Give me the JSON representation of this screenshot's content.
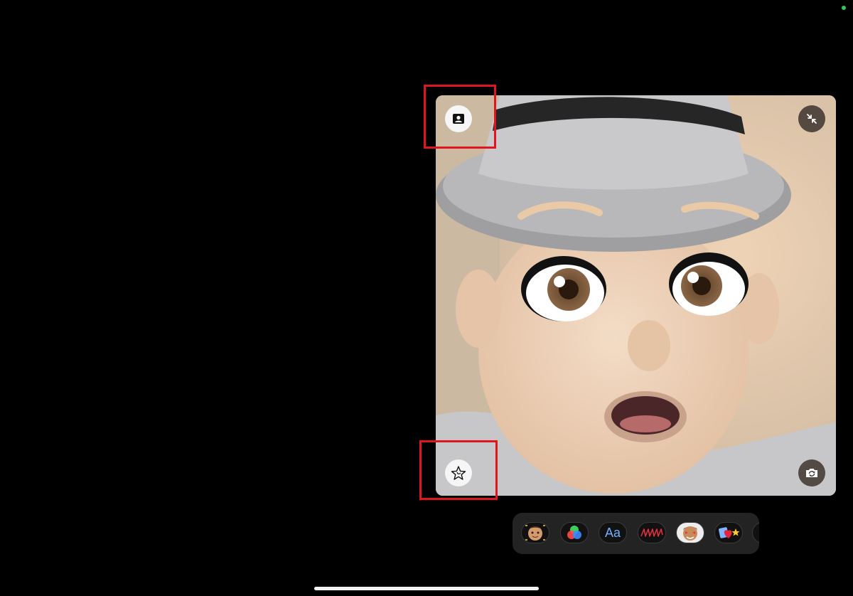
{
  "colors": {
    "background": "#000000",
    "status_dot": "#34c759",
    "highlight": "#e0161e",
    "tray": "#232323",
    "text_effect": "#6fb2ff",
    "home_indicator": "#f2f2f2"
  },
  "camera_tile": {
    "top_left_button": {
      "icon": "person-portrait-icon"
    },
    "top_right_button": {
      "icon": "minimize-arrows-icon"
    },
    "bottom_left_button": {
      "icon": "effects-star-icon"
    },
    "bottom_right_button": {
      "icon": "flip-camera-icon"
    }
  },
  "effects_tray": {
    "items": [
      {
        "name": "memoji",
        "icon": "memoji-face-icon"
      },
      {
        "name": "filters",
        "icon": "color-circles-icon"
      },
      {
        "name": "text",
        "label": "Aa"
      },
      {
        "name": "shapes",
        "icon": "scribble-icon"
      },
      {
        "name": "memoji-stickers",
        "icon": "memoji-sticker-icon"
      },
      {
        "name": "emoji-stickers",
        "icon": "heart-star-icon"
      },
      {
        "name": "more",
        "icon": "partial-item-icon"
      }
    ]
  }
}
